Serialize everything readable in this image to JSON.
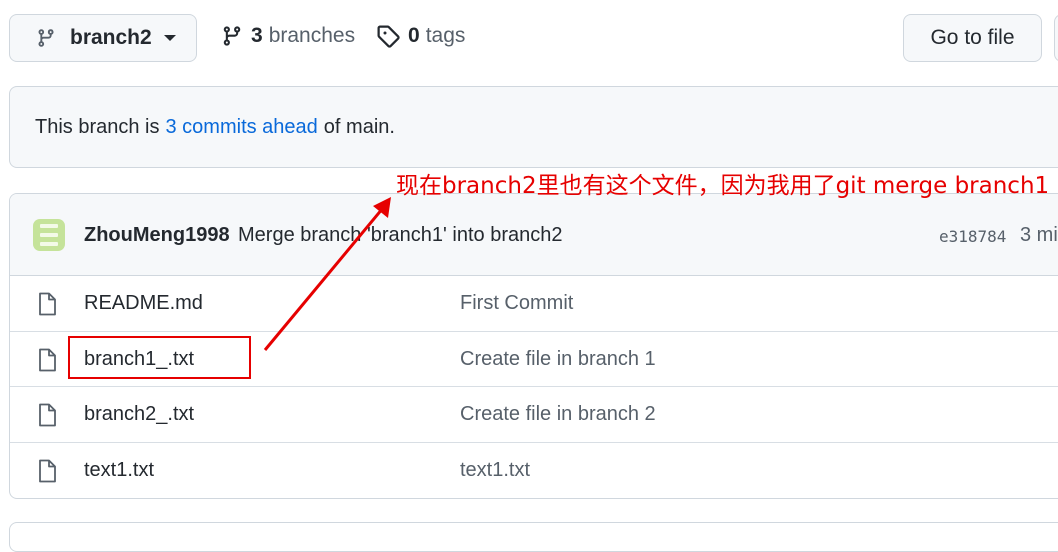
{
  "branch_selector": {
    "label": "branch2",
    "icon": "git-branch-icon",
    "caret": "triangle-down-icon"
  },
  "branches_link": {
    "count": "3",
    "label": "branches",
    "icon": "git-branch-icon"
  },
  "tags_link": {
    "count": "0",
    "label": "tags",
    "icon": "tag-icon"
  },
  "go_to_file": {
    "label": "Go to file"
  },
  "banner": {
    "prefix": "This branch is",
    "link": "3 commits ahead",
    "suffix": "of main."
  },
  "annotation": {
    "text": "现在branch2里也有这个文件，因为我用了git merge branch1",
    "color": "#e60000"
  },
  "latest_commit": {
    "author": "ZhouMeng1998",
    "message": "Merge branch 'branch1' into branch2",
    "sha": "e318784",
    "age": "3 mi"
  },
  "files": [
    {
      "name": "README.md",
      "message": "First Commit",
      "icon": "file-icon"
    },
    {
      "name": "branch1_.txt",
      "message": "Create file in branch 1",
      "icon": "file-icon"
    },
    {
      "name": "branch2_.txt",
      "message": "Create file in branch 2",
      "icon": "file-icon"
    },
    {
      "name": "text1.txt",
      "message": "text1.txt",
      "icon": "file-icon"
    }
  ],
  "colors": {
    "link": "#0969da",
    "annotation": "#e60000",
    "avatar": "#c5e39a"
  }
}
